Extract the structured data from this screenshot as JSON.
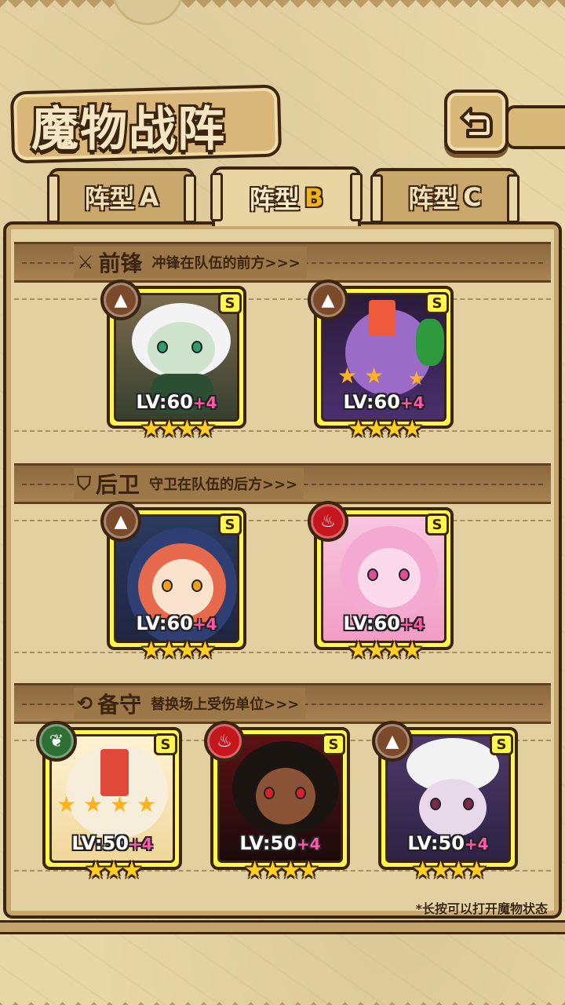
{
  "title": "魔物战阵",
  "back_icon": "back-arrow-icon",
  "tabs": [
    {
      "prefix": "阵型",
      "letter": "A",
      "active": false
    },
    {
      "prefix": "阵型",
      "letter": "B",
      "active": true
    },
    {
      "prefix": "阵型",
      "letter": "C",
      "active": false
    }
  ],
  "sections": {
    "vanguard": {
      "icon": "sword-icon",
      "title": "前锋",
      "desc": "冲锋在队伍的前方>>>"
    },
    "rearguard": {
      "icon": "shield-icon",
      "title": "后卫",
      "desc": "守卫在队伍的后方>>>"
    },
    "reserve": {
      "icon": "swap-icon",
      "title": "备守",
      "desc": "替换场上受伤单位>>>"
    }
  },
  "monsters": {
    "v1": {
      "rank": "S",
      "element": "earth",
      "lv": "LV:60",
      "plus": "+4",
      "stars": "★★★★"
    },
    "v2": {
      "rank": "S",
      "element": "earth",
      "lv": "LV:60",
      "plus": "+4",
      "stars": "★★★★"
    },
    "r1": {
      "rank": "S",
      "element": "earth",
      "lv": "LV:60",
      "plus": "+4",
      "stars": "★★★★"
    },
    "r2": {
      "rank": "S",
      "element": "fire",
      "lv": "LV:60",
      "plus": "+4",
      "stars": "★★★★"
    },
    "b1": {
      "rank": "S",
      "element": "wood",
      "lv": "LV:50",
      "plus": "+4",
      "stars": "★★★"
    },
    "b2": {
      "rank": "S",
      "element": "fire",
      "lv": "LV:50",
      "plus": "+4",
      "stars": "★★★★"
    },
    "b3": {
      "rank": "S",
      "element": "earth",
      "lv": "LV:50",
      "plus": "+4",
      "stars": "★★★★"
    }
  },
  "footer_note": "*长按可以打开魔物状态",
  "colors": {
    "card_frame": "#fff84a",
    "star": "#ffcf1f",
    "outline": "#3b2410",
    "earth": "#7a4a2a",
    "fire": "#c4161c",
    "wood": "#2e6f34"
  }
}
